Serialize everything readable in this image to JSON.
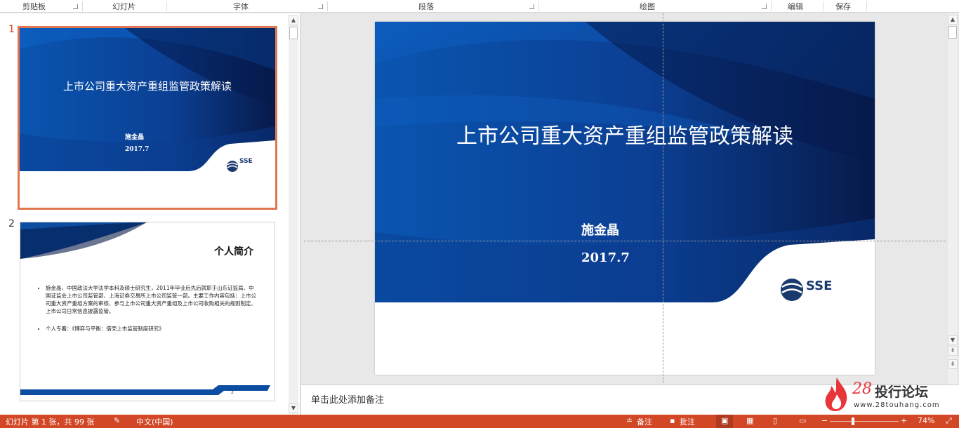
{
  "ribbon": {
    "groups": [
      "剪贴板",
      "幻灯片",
      "字体",
      "段落",
      "绘图",
      "编辑",
      "保存"
    ]
  },
  "thumbnails": [
    {
      "number": "1",
      "title": "上市公司重大资产重组监管政策解读",
      "author": "施金晶",
      "date": "2017.7",
      "logo": "SSE"
    },
    {
      "number": "2",
      "title": "个人简介",
      "bullets": [
        "施金晶，中国政法大学法学本科及硕士研究生，2011年毕业后先后就职于山东证监局、中国证监会上市公司监管部、上海证券交易所上市公司监管一部。主要工作内容包括：上市公司重大资产重组方案的审核、参与上市公司重大资产重组及上市公司收购相关的规则制定、上市公司日常信息披露监管。",
        "个人专著：《博弈与平衡：借壳上市监管制度研究》"
      ],
      "page_no": "2"
    }
  ],
  "slide": {
    "title": "上市公司重大资产重组监管政策解读",
    "author": "施金晶",
    "date": "2017.7",
    "logo": "SSE"
  },
  "notes": {
    "placeholder": "单击此处添加备注"
  },
  "status": {
    "slide_info": "幻灯片 第 1 张，共 99 张",
    "language": "中文(中国)",
    "notes_btn": "备注",
    "comments_btn": "批注",
    "zoom": "74%"
  },
  "watermark": {
    "number": "28",
    "name": "投行论坛",
    "url": "www.28touhang.com"
  },
  "colors": {
    "accent": "#d24726",
    "slide_blue": "#0b4ea2",
    "slide_dark": "#071a4a"
  }
}
